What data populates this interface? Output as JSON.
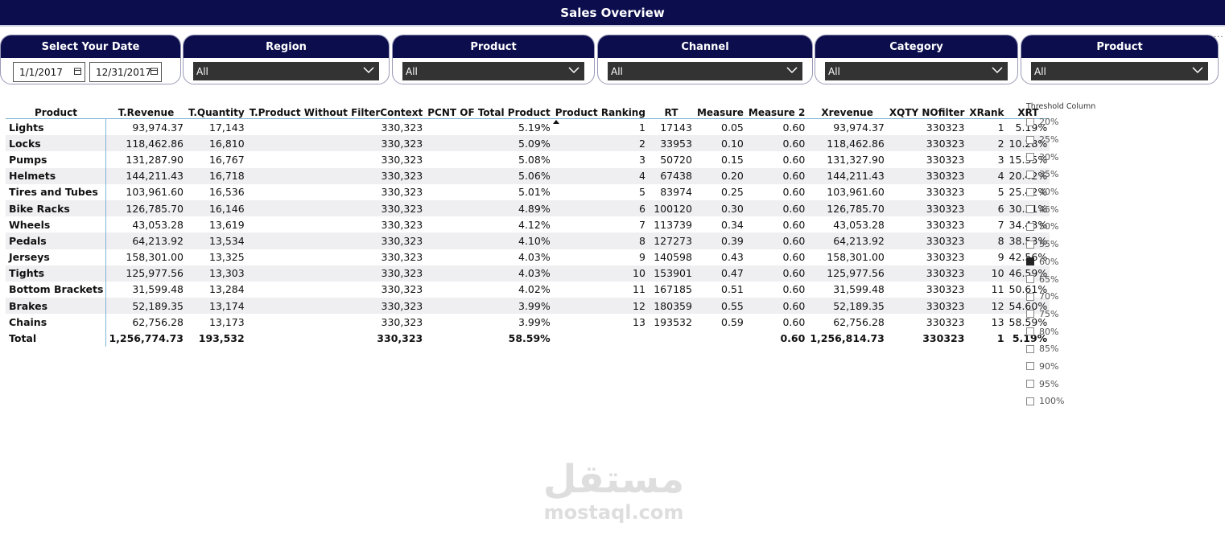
{
  "header": {
    "title": "Sales Overview"
  },
  "date_slicer": {
    "title": "Select Your Date",
    "start": "1/1/2017",
    "end": "12/31/2017"
  },
  "slicers": [
    {
      "title": "Region",
      "value": "All"
    },
    {
      "title": "Product",
      "value": "All"
    },
    {
      "title": "Channel",
      "value": "All"
    },
    {
      "title": "Category",
      "value": "All"
    },
    {
      "title": "Product",
      "value": "All"
    }
  ],
  "table": {
    "columns": [
      "Product",
      "T.Revenue",
      "T.Quantity",
      "T.Product Without FilterContext",
      "PCNT OF Total Product",
      "Product Ranking",
      "RT",
      "Measure",
      "Measure 2",
      "Xrevenue",
      "XQTY NOfilter",
      "XRank",
      "XRT"
    ],
    "rows": [
      [
        "Lights",
        "93,974.37",
        "17,143",
        "330,323",
        "5.19%",
        "1",
        "17143",
        "0.05",
        "0.60",
        "93,974.37",
        "330323",
        "1",
        "5.19%"
      ],
      [
        "Locks",
        "118,462.86",
        "16,810",
        "330,323",
        "5.09%",
        "2",
        "33953",
        "0.10",
        "0.60",
        "118,462.86",
        "330323",
        "2",
        "10.28%"
      ],
      [
        "Pumps",
        "131,287.90",
        "16,767",
        "330,323",
        "5.08%",
        "3",
        "50720",
        "0.15",
        "0.60",
        "131,327.90",
        "330323",
        "3",
        "15.35%"
      ],
      [
        "Helmets",
        "144,211.43",
        "16,718",
        "330,323",
        "5.06%",
        "4",
        "67438",
        "0.20",
        "0.60",
        "144,211.43",
        "330323",
        "4",
        "20.42%"
      ],
      [
        "Tires and Tubes",
        "103,961.60",
        "16,536",
        "330,323",
        "5.01%",
        "5",
        "83974",
        "0.25",
        "0.60",
        "103,961.60",
        "330323",
        "5",
        "25.42%"
      ],
      [
        "Bike Racks",
        "126,785.70",
        "16,146",
        "330,323",
        "4.89%",
        "6",
        "100120",
        "0.30",
        "0.60",
        "126,785.70",
        "330323",
        "6",
        "30.31%"
      ],
      [
        "Wheels",
        "43,053.28",
        "13,619",
        "330,323",
        "4.12%",
        "7",
        "113739",
        "0.34",
        "0.60",
        "43,053.28",
        "330323",
        "7",
        "34.43%"
      ],
      [
        "Pedals",
        "64,213.92",
        "13,534",
        "330,323",
        "4.10%",
        "8",
        "127273",
        "0.39",
        "0.60",
        "64,213.92",
        "330323",
        "8",
        "38.53%"
      ],
      [
        "Jerseys",
        "158,301.00",
        "13,325",
        "330,323",
        "4.03%",
        "9",
        "140598",
        "0.43",
        "0.60",
        "158,301.00",
        "330323",
        "9",
        "42.56%"
      ],
      [
        "Tights",
        "125,977.56",
        "13,303",
        "330,323",
        "4.03%",
        "10",
        "153901",
        "0.47",
        "0.60",
        "125,977.56",
        "330323",
        "10",
        "46.59%"
      ],
      [
        "Bottom Brackets",
        "31,599.48",
        "13,284",
        "330,323",
        "4.02%",
        "11",
        "167185",
        "0.51",
        "0.60",
        "31,599.48",
        "330323",
        "11",
        "50.61%"
      ],
      [
        "Brakes",
        "52,189.35",
        "13,174",
        "330,323",
        "3.99%",
        "12",
        "180359",
        "0.55",
        "0.60",
        "52,189.35",
        "330323",
        "12",
        "54.60%"
      ],
      [
        "Chains",
        "62,756.28",
        "13,173",
        "330,323",
        "3.99%",
        "13",
        "193532",
        "0.59",
        "0.60",
        "62,756.28",
        "330323",
        "13",
        "58.59%"
      ]
    ],
    "total": [
      "Total",
      "1,256,774.73",
      "193,532",
      "330,323",
      "58.59%",
      "",
      "",
      "",
      "0.60",
      "1,256,814.73",
      "330323",
      "1",
      "5.19%"
    ]
  },
  "threshold": {
    "title": "Threshold Column",
    "options": [
      "20%",
      "25%",
      "30%",
      "35%",
      "40%",
      "45%",
      "50%",
      "55%",
      "60%",
      "65%",
      "70%",
      "75%",
      "80%",
      "85%",
      "90%",
      "95%",
      "100%"
    ],
    "selected": "60%"
  },
  "watermark": {
    "arabic": "مستقل",
    "latin": "mostaql.com"
  },
  "icons": {
    "dropdown": "chevron-down-icon",
    "date": "calendar-icon",
    "more": "more-options-icon"
  },
  "colors": {
    "header_bg": "#0b0d4d",
    "dropdown_bg": "#333333",
    "row_alt": "#efeef1",
    "rule": "#7fb4d6"
  }
}
